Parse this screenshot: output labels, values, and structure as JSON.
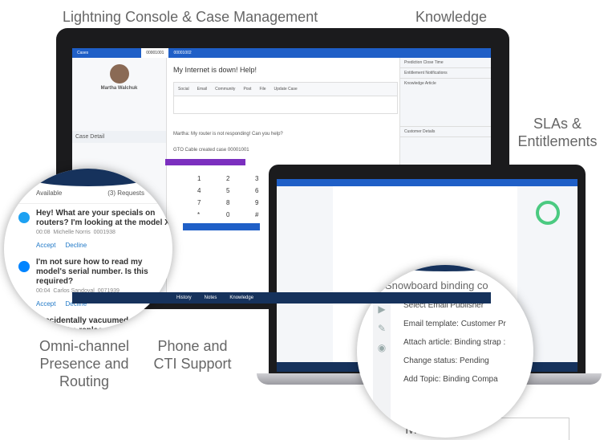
{
  "labels": {
    "console": "Lightning Console & Case Management",
    "knowledge": "Knowledge",
    "slas": "SLAs & Entitlements",
    "omni": "Omni-channel Presence and Routing",
    "phone": "Phone and CTI Support",
    "macros": "Macros"
  },
  "console": {
    "tabs": [
      "Cases",
      "00001001",
      "00001002"
    ],
    "contact_name": "Martha Walchuk",
    "case_title": "My Internet is down! Help!",
    "publisher_tabs": [
      "Social",
      "Email",
      "Community",
      "Post",
      "File",
      "Update Case"
    ],
    "case_detail": "Case Detail",
    "feed": [
      "Martha: My router is not responding! Can you help?",
      "GTO Cable created case 00001001"
    ],
    "right_panel": [
      "Prediction Close Time",
      "Entitlement Notifications",
      "Knowledge Article",
      "Customer Details"
    ],
    "footer": [
      "History",
      "Notes",
      "Knowledge"
    ]
  },
  "omni": {
    "header": "Available",
    "requests": "(3) Requests",
    "items": [
      {
        "text": "Hey! What are your specials on routers? I'm looking at the model X.",
        "time": "00:08",
        "name": "Michelle Norris",
        "id": "0001938",
        "channel": "twitter-icon"
      },
      {
        "text": "I'm not sure how to read my model's serial number. Is this required?",
        "time": "00:04",
        "name": "Carlos Sandoval",
        "id": "0071939",
        "channel": "messenger-icon"
      },
      {
        "text": "I accidentally vacuumed over ... Can I get a replacem..."
      }
    ],
    "accept": "Accept",
    "decline": "Decline"
  },
  "macros": {
    "title": "Snowboard binding co",
    "steps": [
      "Select Email Publisher",
      "Email template: Customer Pr",
      "Attach article:  Binding strap :",
      "Change status: Pending",
      "Add Topic: Binding Compa"
    ]
  }
}
